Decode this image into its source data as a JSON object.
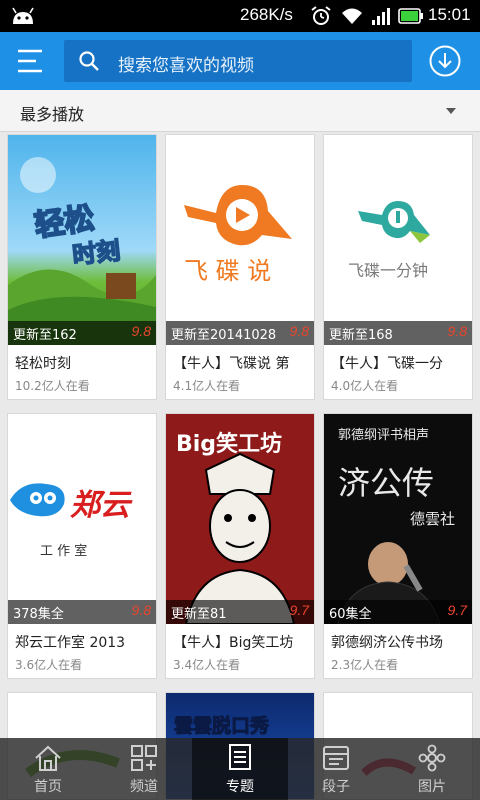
{
  "status_bar": {
    "speed": "268K/s",
    "time": "15:01",
    "icons": [
      "android-icon",
      "alarm-icon",
      "wifi-icon",
      "signal-icon",
      "battery-icon"
    ]
  },
  "top_bar": {
    "search_placeholder": "搜索您喜欢的视频",
    "accent_color": "#1e90e6"
  },
  "sort": {
    "label": "最多播放"
  },
  "cards": [
    {
      "title": "轻松时刻",
      "views": "10.2亿人在看",
      "update": "更新至162",
      "score": "9.8",
      "thumb_text": [
        "轻松",
        "时刻"
      ]
    },
    {
      "title": "【牛人】飞碟说 第",
      "views": "4.1亿人在看",
      "update": "更新至20141028",
      "score": "9.8",
      "thumb_text": [
        "飞 碟 说"
      ]
    },
    {
      "title": "【牛人】飞碟一分",
      "views": "4.0亿人在看",
      "update": "更新至168",
      "score": "9.8",
      "thumb_text": [
        "飞碟一分钟"
      ]
    },
    {
      "title": "郑云工作室 2013",
      "views": "3.6亿人在看",
      "update": "378集全",
      "score": "9.8",
      "thumb_text": [
        "郑云",
        "工  作  室"
      ]
    },
    {
      "title": "【牛人】Big笑工坊",
      "views": "3.4亿人在看",
      "update": "更新至81",
      "score": "9.7",
      "thumb_text": [
        "Big笑工坊"
      ]
    },
    {
      "title": "郭德纲济公传书场",
      "views": "2.3亿人在看",
      "update": "60集全",
      "score": "9.7",
      "thumb_text": [
        "郭德纲评书相声",
        "济公传",
        "德雲社"
      ]
    },
    {
      "thumb_text": []
    },
    {
      "thumb_text": [
        "雲雲脱口秀"
      ]
    },
    {
      "thumb_text": []
    }
  ],
  "bottom_nav": [
    {
      "label": "首页",
      "icon": "home-icon"
    },
    {
      "label": "频道",
      "icon": "channel-icon"
    },
    {
      "label": "专题",
      "icon": "topic-icon",
      "active": true
    },
    {
      "label": "段子",
      "icon": "jokes-icon"
    },
    {
      "label": "图片",
      "icon": "picture-icon"
    }
  ]
}
